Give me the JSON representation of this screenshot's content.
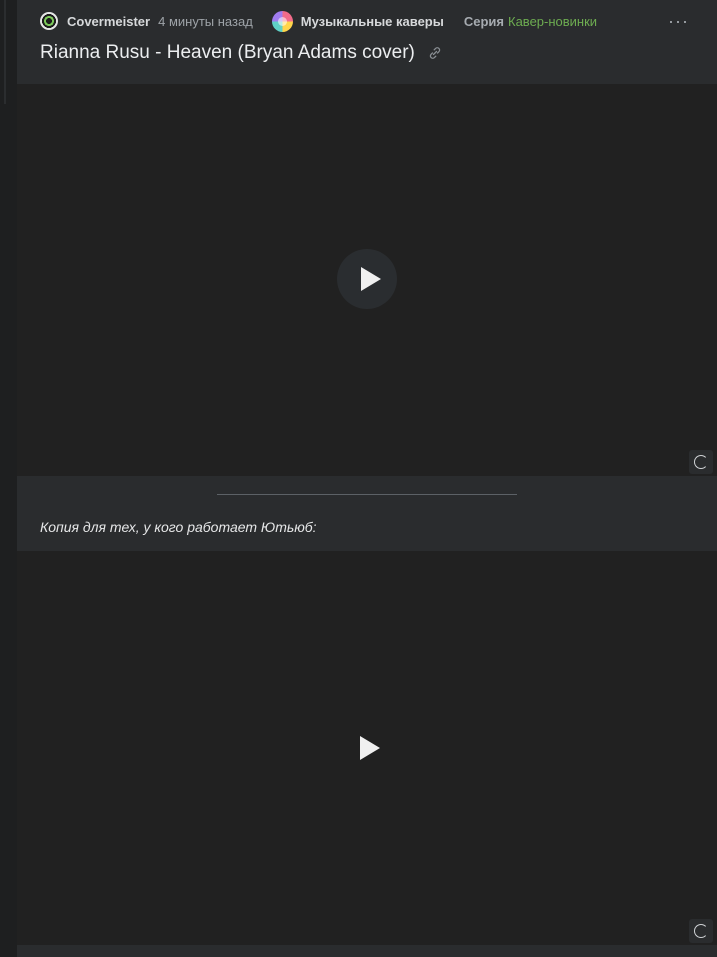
{
  "post": {
    "author": "Covermeister",
    "time": "4 минуты назад",
    "subsite": "Музыкальные каверы",
    "series_label": "Серия",
    "series_name": "Кавер-новинки",
    "more": "···",
    "title": "Rianna Rusu - Heaven (Bryan Adams cover)"
  },
  "body": {
    "caption": "Копия для тех, у кого работает Ютьюб:"
  },
  "icons": {
    "avatar": "vinyl-avatar-icon",
    "subsite": "colorful-subsite-icon",
    "link": "link-icon",
    "play": "play-icon",
    "loading": "loading-spinner-icon"
  },
  "colors": {
    "card": "#2a2c2e",
    "video": "#212121",
    "series_link": "#6dac51"
  }
}
